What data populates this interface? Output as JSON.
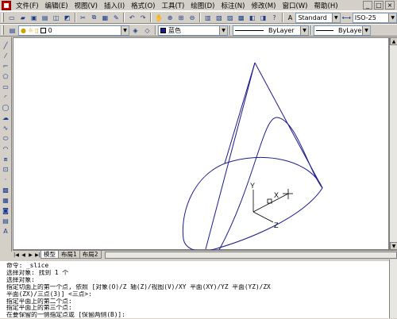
{
  "menu": [
    "文件(F)",
    "编辑(E)",
    "视图(V)",
    "插入(I)",
    "格式(O)",
    "工具(T)",
    "绘图(D)",
    "标注(N)",
    "修改(M)",
    "窗口(W)",
    "帮助(H)"
  ],
  "window_controls": [
    "_",
    "□",
    "×"
  ],
  "styles": {
    "text_style": "Standard",
    "dim_style": "ISO-25"
  },
  "layer": {
    "name": "0"
  },
  "color_control": "蓝色",
  "linetype": "ByLayer",
  "lineweight": "ByLayer",
  "tabs": [
    "模型",
    "布局1",
    "布局2"
  ],
  "ucs": {
    "x": "X",
    "y": "Y",
    "z": "Z"
  },
  "command_lines": [
    "命令: _slice",
    "选择对象: 找到 1 个",
    "选择对象:",
    "指定切面上的第一个点, 依照 [对象(O)/Z 轴(Z)/视图(V)/XY 平面(XY)/YZ 平面(YZ)/ZX",
    "平面(ZX)/三点(3)] <三点>:",
    "指定平面上的第二个点:",
    "指定平面上的第三个点:",
    "在要保留的一侧指定点或 [保留两侧(B)]:"
  ],
  "colors": {
    "wireframe": "#1b1b8e",
    "background": "#d4d0c8"
  }
}
